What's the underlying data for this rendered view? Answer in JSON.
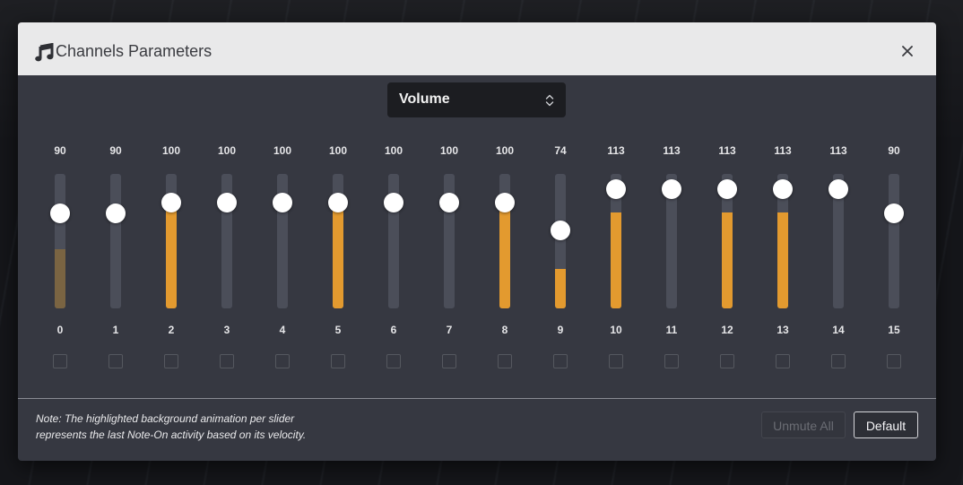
{
  "dialog": {
    "title": "Channels Parameters",
    "title_icon": "music-note-icon",
    "close_icon": "close-icon"
  },
  "parameter_select": {
    "value": "Volume",
    "arrow_icon": "chevron-up-down-icon"
  },
  "colors": {
    "activity_bright": "#e39a2f",
    "activity_faded": "#7a6442",
    "track": "#4b4e59",
    "thumb": "#ffffff"
  },
  "channels": [
    {
      "label": "0",
      "value": "90",
      "level": 0.709,
      "activity": 0.44,
      "active": "faded"
    },
    {
      "label": "1",
      "value": "90",
      "level": 0.709,
      "activity": 0,
      "active": "none"
    },
    {
      "label": "2",
      "value": "100",
      "level": 0.787,
      "activity": 0.74,
      "active": "bright"
    },
    {
      "label": "3",
      "value": "100",
      "level": 0.787,
      "activity": 0,
      "active": "none"
    },
    {
      "label": "4",
      "value": "100",
      "level": 0.787,
      "activity": 0,
      "active": "none"
    },
    {
      "label": "5",
      "value": "100",
      "level": 0.787,
      "activity": 0.74,
      "active": "bright"
    },
    {
      "label": "6",
      "value": "100",
      "level": 0.787,
      "activity": 0,
      "active": "none"
    },
    {
      "label": "7",
      "value": "100",
      "level": 0.787,
      "activity": 0,
      "active": "none"
    },
    {
      "label": "8",
      "value": "100",
      "level": 0.787,
      "activity": 0.74,
      "active": "bright"
    },
    {
      "label": "9",
      "value": "74",
      "level": 0.583,
      "activity": 0.29,
      "active": "bright"
    },
    {
      "label": "10",
      "value": "113",
      "level": 0.89,
      "activity": 0.71,
      "active": "bright"
    },
    {
      "label": "11",
      "value": "113",
      "level": 0.89,
      "activity": 0,
      "active": "none"
    },
    {
      "label": "12",
      "value": "113",
      "level": 0.89,
      "activity": 0.71,
      "active": "bright"
    },
    {
      "label": "13",
      "value": "113",
      "level": 0.89,
      "activity": 0.71,
      "active": "bright"
    },
    {
      "label": "14",
      "value": "113",
      "level": 0.89,
      "activity": 0,
      "active": "none"
    },
    {
      "label": "15",
      "value": "90",
      "level": 0.709,
      "activity": 0,
      "active": "none"
    }
  ],
  "footer": {
    "note_line1": "Note: The highlighted background animation per slider",
    "note_line2": "represents the last Note-On activity based on its velocity.",
    "unmute_all_label": "Unmute All",
    "default_label": "Default"
  }
}
